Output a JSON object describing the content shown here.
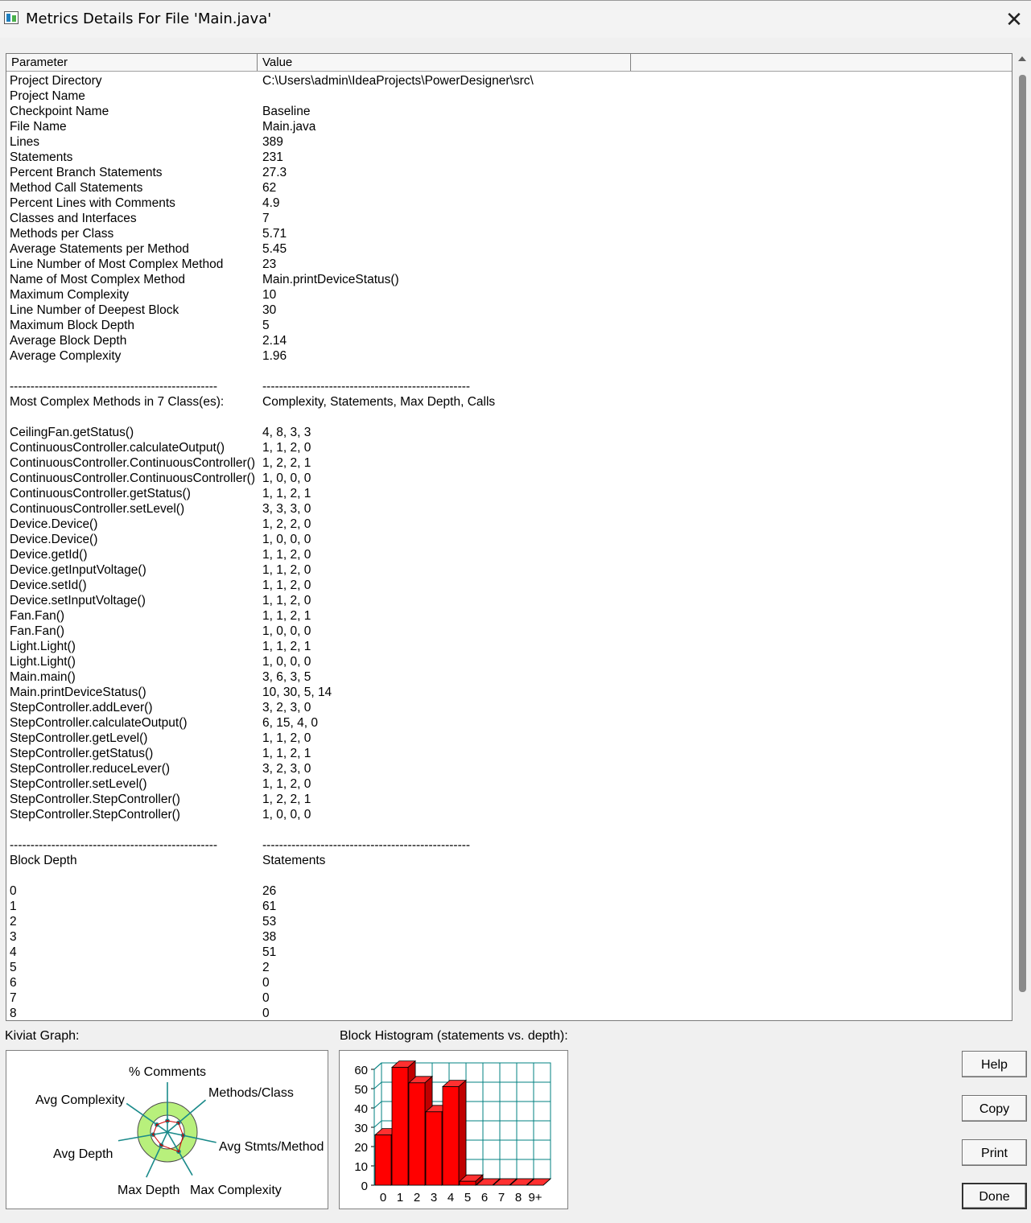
{
  "window": {
    "title": "Metrics Details For File 'Main.java'"
  },
  "table": {
    "headers": [
      "Parameter",
      "Value"
    ],
    "rows": [
      [
        "Project Directory",
        "C:\\Users\\admin\\IdeaProjects\\PowerDesigner\\src\\"
      ],
      [
        "Project Name",
        ""
      ],
      [
        "Checkpoint Name",
        "Baseline"
      ],
      [
        "File Name",
        "Main.java"
      ],
      [
        "Lines",
        "389"
      ],
      [
        "Statements",
        "231"
      ],
      [
        "Percent Branch Statements",
        "27.3"
      ],
      [
        "Method Call Statements",
        "62"
      ],
      [
        "Percent Lines with Comments",
        "4.9"
      ],
      [
        "Classes and Interfaces",
        "7"
      ],
      [
        "Methods per Class",
        "5.71"
      ],
      [
        "Average Statements per Method",
        "5.45"
      ],
      [
        "Line Number of Most Complex Method",
        "23"
      ],
      [
        "Name of Most Complex Method",
        "Main.printDeviceStatus()"
      ],
      [
        "Maximum Complexity",
        "10"
      ],
      [
        "Line Number of Deepest Block",
        "30"
      ],
      [
        "Maximum Block Depth",
        "5"
      ],
      [
        "Average Block Depth",
        "2.14"
      ],
      [
        "Average Complexity",
        "1.96"
      ],
      [
        "",
        ""
      ],
      [
        "--------------------------------------------------",
        "--------------------------------------------------"
      ],
      [
        "Most Complex Methods in 7 Class(es):",
        "Complexity, Statements, Max Depth, Calls"
      ],
      [
        "",
        ""
      ],
      [
        "CeilingFan.getStatus()",
        "4, 8, 3, 3"
      ],
      [
        "ContinuousController.calculateOutput()",
        "1, 1, 2, 0"
      ],
      [
        "ContinuousController.ContinuousController()",
        "1, 2, 2, 1"
      ],
      [
        "ContinuousController.ContinuousController()",
        "1, 0, 0, 0"
      ],
      [
        "ContinuousController.getStatus()",
        "1, 1, 2, 1"
      ],
      [
        "ContinuousController.setLevel()",
        "3, 3, 3, 0"
      ],
      [
        "Device.Device()",
        "1, 2, 2, 0"
      ],
      [
        "Device.Device()",
        "1, 0, 0, 0"
      ],
      [
        "Device.getId()",
        "1, 1, 2, 0"
      ],
      [
        "Device.getInputVoltage()",
        "1, 1, 2, 0"
      ],
      [
        "Device.setId()",
        "1, 1, 2, 0"
      ],
      [
        "Device.setInputVoltage()",
        "1, 1, 2, 0"
      ],
      [
        "Fan.Fan()",
        "1, 1, 2, 1"
      ],
      [
        "Fan.Fan()",
        "1, 0, 0, 0"
      ],
      [
        "Light.Light()",
        "1, 1, 2, 1"
      ],
      [
        "Light.Light()",
        "1, 0, 0, 0"
      ],
      [
        "Main.main()",
        "3, 6, 3, 5"
      ],
      [
        "Main.printDeviceStatus()",
        "10, 30, 5, 14"
      ],
      [
        "StepController.addLever()",
        "3, 2, 3, 0"
      ],
      [
        "StepController.calculateOutput()",
        "6, 15, 4, 0"
      ],
      [
        "StepController.getLevel()",
        "1, 1, 2, 0"
      ],
      [
        "StepController.getStatus()",
        "1, 1, 2, 1"
      ],
      [
        "StepController.reduceLever()",
        "3, 2, 3, 0"
      ],
      [
        "StepController.setLevel()",
        "1, 1, 2, 0"
      ],
      [
        "StepController.StepController()",
        "1, 2, 2, 1"
      ],
      [
        "StepController.StepController()",
        "1, 0, 0, 0"
      ],
      [
        "",
        ""
      ],
      [
        "--------------------------------------------------",
        "--------------------------------------------------"
      ],
      [
        "Block Depth",
        "Statements"
      ],
      [
        "",
        ""
      ],
      [
        "0",
        "26"
      ],
      [
        "1",
        "61"
      ],
      [
        "2",
        "53"
      ],
      [
        "3",
        "38"
      ],
      [
        "4",
        "51"
      ],
      [
        "5",
        "2"
      ],
      [
        "6",
        "0"
      ],
      [
        "7",
        "0"
      ],
      [
        "8",
        "0"
      ]
    ]
  },
  "kiviat": {
    "label": "Kiviat Graph:",
    "axes": [
      "% Comments",
      "Methods/Class",
      "Avg Stmts/Method",
      "Max Complexity",
      "Max Depth",
      "Avg Depth",
      "Avg Complexity"
    ]
  },
  "histogram": {
    "label": "Block Histogram (statements vs. depth):",
    "y_ticks": [
      "0",
      "10",
      "20",
      "30",
      "40",
      "50",
      "60"
    ],
    "categories": [
      "0",
      "1",
      "2",
      "3",
      "4",
      "5",
      "6",
      "7",
      "8",
      "9+"
    ],
    "values": [
      26,
      61,
      53,
      38,
      51,
      2,
      0,
      0,
      0,
      0
    ],
    "bar_color": "#ff0000",
    "grid_color": "#008080"
  },
  "buttons": {
    "help": "Help",
    "copy": "Copy",
    "print": "Print",
    "done": "Done"
  }
}
